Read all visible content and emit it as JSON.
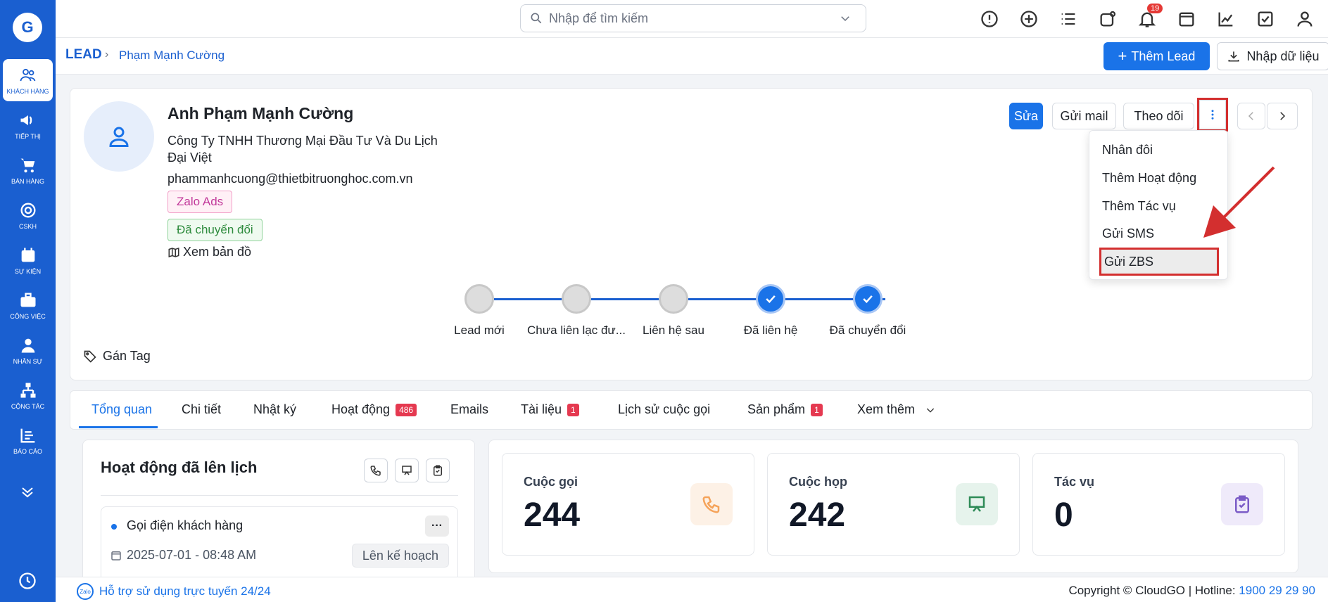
{
  "sidebar": {
    "logo": "G",
    "items": [
      {
        "label": "KHÁCH HÀNG",
        "icon": "users-icon"
      },
      {
        "label": "TIẾP THỊ",
        "icon": "megaphone-icon"
      },
      {
        "label": "BÁN HÀNG",
        "icon": "cart-icon"
      },
      {
        "label": "CSKH",
        "icon": "lifebuoy-icon"
      },
      {
        "label": "SỰ KIỆN",
        "icon": "calendar-icon"
      },
      {
        "label": "CÔNG VIỆC",
        "icon": "briefcase-icon"
      },
      {
        "label": "NHÂN SỰ",
        "icon": "person-icon"
      },
      {
        "label": "CỘNG TÁC",
        "icon": "org-chart-icon"
      },
      {
        "label": "BÁO CÁO",
        "icon": "report-icon"
      }
    ]
  },
  "topbar": {
    "search_placeholder": "Nhập để tìm kiếm",
    "notification_count": "19"
  },
  "breadcrumb": {
    "module": "LEAD",
    "current": "Phạm Mạnh Cường"
  },
  "actions": {
    "add_lead": "Thêm Lead",
    "import": "Nhập dữ liệu"
  },
  "lead": {
    "name": "Anh Phạm Mạnh Cường",
    "company": "Công Ty TNHH Thương Mại Đầu Tư Và Du Lịch Đại Việt",
    "email": "phammanhcuong@thietbitruonghoc.com.vn",
    "source_tag": "Zalo Ads",
    "status_tag": "Đã chuyển đổi",
    "map_link": "Xem bản đồ",
    "assign_tag": "Gán Tag",
    "buttons": {
      "edit": "Sửa",
      "send_mail": "Gửi mail",
      "follow": "Theo dõi"
    }
  },
  "stages": [
    {
      "label": "Lead mới",
      "done": false
    },
    {
      "label": "Chưa liên lạc đư...",
      "done": false
    },
    {
      "label": "Liên hệ sau",
      "done": false
    },
    {
      "label": "Đã liên hệ",
      "done": true
    },
    {
      "label": "Đã chuyển đổi",
      "done": true
    }
  ],
  "dropdown": {
    "items": [
      "Nhân đôi",
      "Thêm Hoạt động",
      "Thêm Tác vụ",
      "Gửi SMS",
      "Gửi ZBS"
    ]
  },
  "tabs": [
    {
      "label": "Tổng quan",
      "count": ""
    },
    {
      "label": "Chi tiết",
      "count": ""
    },
    {
      "label": "Nhật ký",
      "count": ""
    },
    {
      "label": "Hoạt động",
      "count": "486"
    },
    {
      "label": "Emails",
      "count": ""
    },
    {
      "label": "Tài liệu",
      "count": "1"
    },
    {
      "label": "Lịch sử cuộc gọi",
      "count": ""
    },
    {
      "label": "Sản phẩm",
      "count": "1"
    },
    {
      "label": "Xem thêm",
      "count": ""
    }
  ],
  "scheduled": {
    "title": "Hoạt động đã lên lịch",
    "activity": {
      "name": "Gọi điện khách hàng",
      "datetime": "2025-07-01 - 08:48 AM",
      "status": "Lên kế hoạch"
    }
  },
  "stats": [
    {
      "label": "Cuộc gọi",
      "value": "244",
      "icon": "phone-icon",
      "color": "#f5a35a",
      "bg": "#fdf1e6"
    },
    {
      "label": "Cuộc họp",
      "value": "242",
      "icon": "presentation-icon",
      "color": "#2e8b57",
      "bg": "#e6f3ec"
    },
    {
      "label": "Tác vụ",
      "value": "0",
      "icon": "clipboard-check-icon",
      "color": "#7b5cc7",
      "bg": "#efeafa"
    }
  ],
  "footer": {
    "support": "Hỗ trợ sử dụng trực tuyến 24/24",
    "zalo_label": "Zalo",
    "copyright": "Copyright © CloudGO",
    "hotline_label": "Hotline:",
    "hotline": "1900 29 29 90"
  },
  "colors": {
    "primary": "#1a73e8",
    "sidebar": "#1a5fd0",
    "highlight_box": "#d32f2f"
  }
}
